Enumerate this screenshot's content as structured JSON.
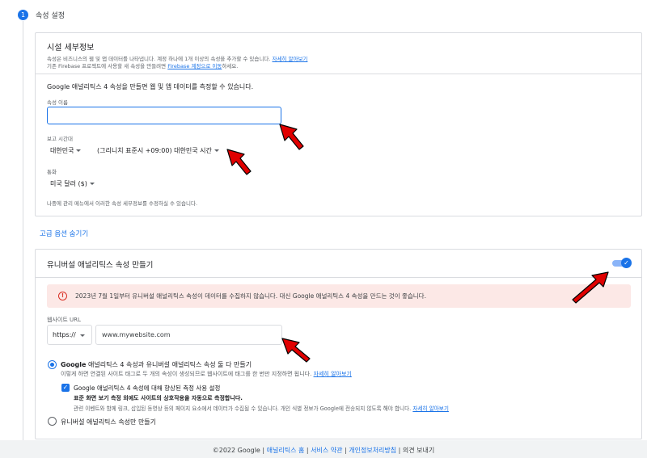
{
  "step": {
    "number": "1",
    "title": "속성 설정"
  },
  "property_details": {
    "title": "시설 세부정보",
    "desc_line1": "속성은 비즈니스의 웹 및 앱 데이터를 나타냅니다. 계정 하나에 1개 이상의 속성을 추가할 수 있습니다.",
    "desc_line1_link": "자세히 알아보기",
    "desc_line2_pre": "기존 Firebase 프로젝트에 사용할 새 속성을 만들려면",
    "desc_line2_link": "Firebase 계정으로 이동",
    "desc_line2_post": "하세요.",
    "intro": "Google 애널리틱스 4 속성을 만들면 웹 및 앱 데이터를 측정할 수 있습니다.",
    "name_label": "속성 이름",
    "name_value": "",
    "timezone_label": "보고 시간대",
    "timezone_country": "대한민국",
    "timezone_value": "(그리니치 표준시 +09:00) 대한민국 시간",
    "currency_label": "통화",
    "currency_value": "미국 달러 ($)",
    "note": "나중에 관리 메뉴에서 이러한 속성 세부정보를 수정하실 수 있습니다."
  },
  "advanced_link": "고급 옵션 숨기기",
  "universal": {
    "title": "유니버설 애널리틱스 속성 만들기",
    "toggle_on": true,
    "alert": "2023년 7월 1일부터 유니버설 애널리틱스 속성이 데이터를 수집하지 않습니다. 대신 Google 애널리틱스 4 속성을 만드는 것이 좋습니다.",
    "url_label": "웹사이트 URL",
    "protocol": "https://",
    "url_placeholder": "www.mywebsite.com",
    "option1_title": "애널리틱스 4 속성과 유니버설 애널리틱스 속성 둘 다 만들기",
    "option1_brand": "Google",
    "option1_sub": "이렇게 하면 연결된 사이트 태그로 두 개의 속성이 생성되므로 웹사이트에 태그를 한 번만 지정하면 됩니다.",
    "option1_link": "자세히 알아보기",
    "check_title": "Google 애널리틱스 4 속성에 대해 향상된 측정 사용 설정",
    "check_bold": "표준 화면 보기 측정 외에도 사이트의 상호작용을 자동으로 측정합니다.",
    "check_sub": "관련 이벤트와 함께 링크, 삽입된 동영상 등의 페이지 요소에서 데이터가 수집될 수 있습니다. 개인 식별 정보가 Google에 전송되지 않도록 해야 합니다.",
    "check_link": "자세히 알아보기",
    "option2_title": "유니버설 애널리틱스 속성만 만들기"
  },
  "footer": {
    "copyright": "©2022 Google",
    "links": [
      "애널리틱스 홈",
      "서비스 약관",
      "개인정보처리방침"
    ],
    "feedback": "의견 보내기"
  },
  "colors": {
    "accent": "#1a73e8",
    "alert_bg": "#fce8e6",
    "error": "#d93025",
    "arrow": "#e00000"
  }
}
